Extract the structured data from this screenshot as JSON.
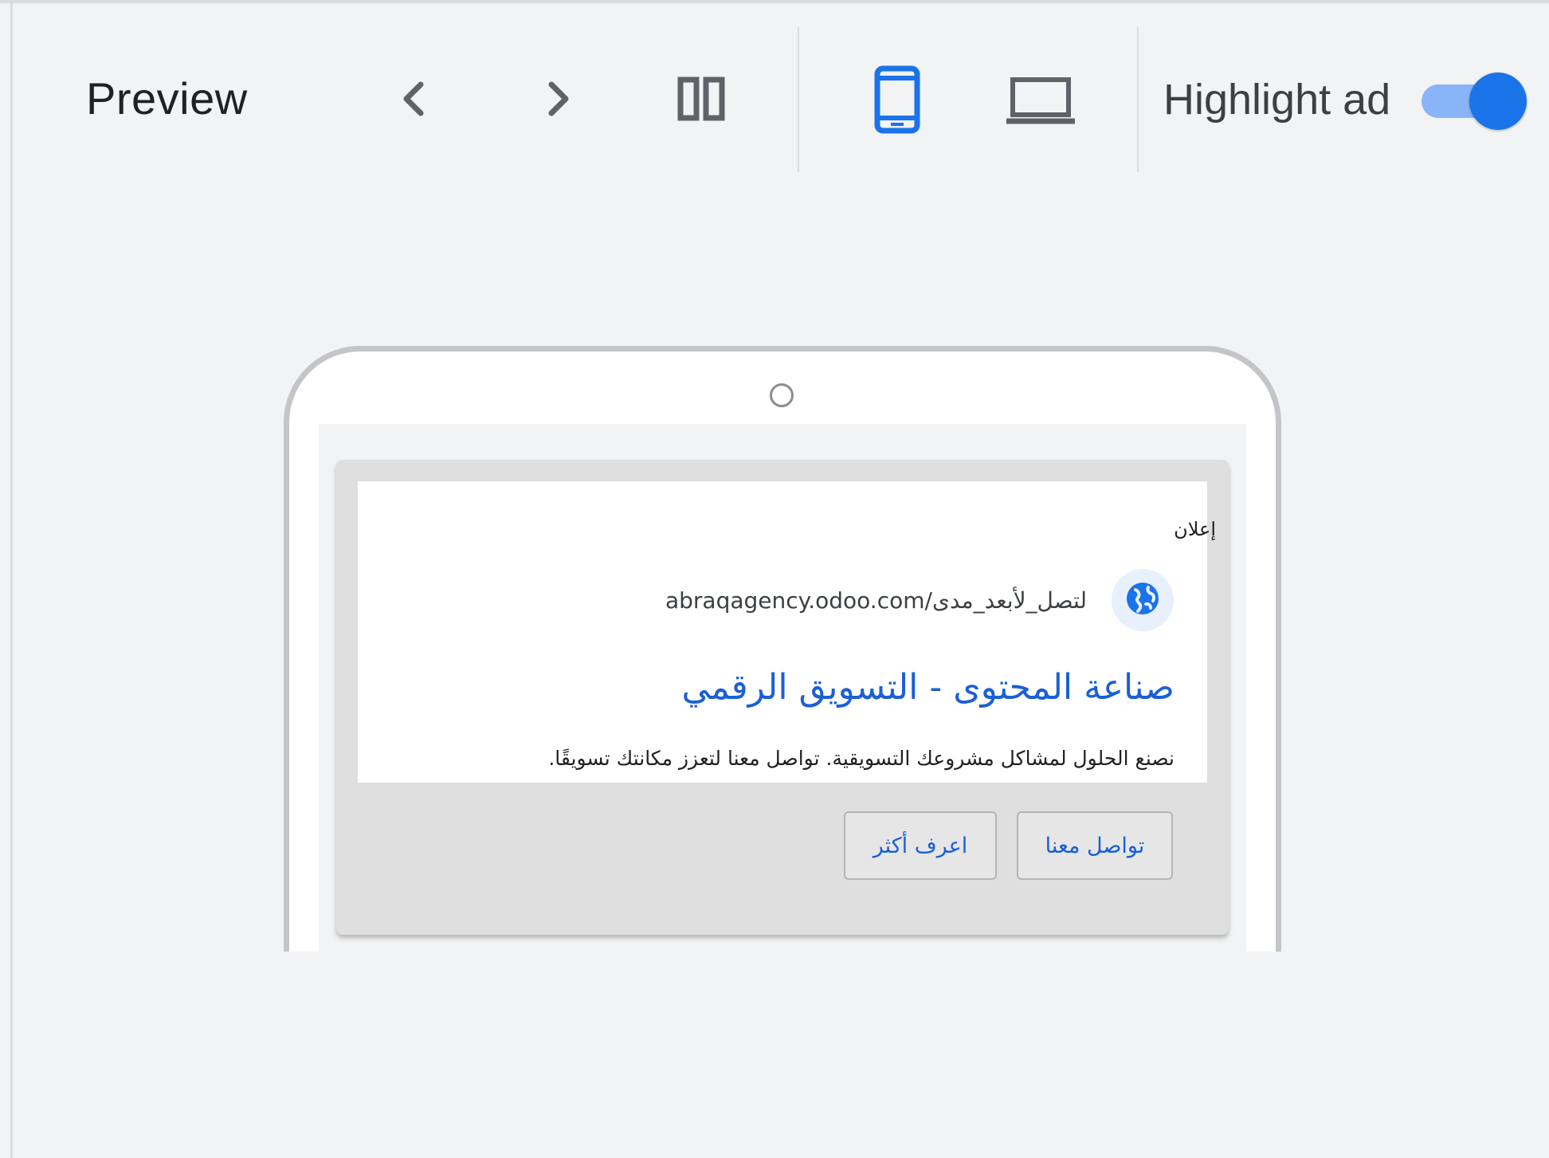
{
  "toolbar": {
    "title": "Preview",
    "prev_icon": "chevron-left-icon",
    "next_icon": "chevron-right-icon",
    "split_icon": "split-view-icon",
    "mobile_icon": "mobile-device-icon",
    "desktop_icon": "laptop-icon",
    "highlight_label": "Highlight ad",
    "highlight_on": true
  },
  "ad": {
    "label": "إعلان",
    "url": "abraqagency.odoo.com/لتصل_لأبعد_مدى",
    "globe_icon": "globe-icon",
    "headline": "صناعة المحتوى - التسويق الرقمي",
    "description": "نصنع الحلول لمشاكل مشروعك التسويقية. تواصل معنا لتعزز مكانتك تسويقًا.",
    "buttons": {
      "contact": "تواصل معنا",
      "learn_more": "اعرف أكثر"
    }
  },
  "colors": {
    "accent": "#1a73e8",
    "toggle_track": "#8ab4f8",
    "link": "#1a5fd6",
    "background": "#f1f3f4"
  }
}
